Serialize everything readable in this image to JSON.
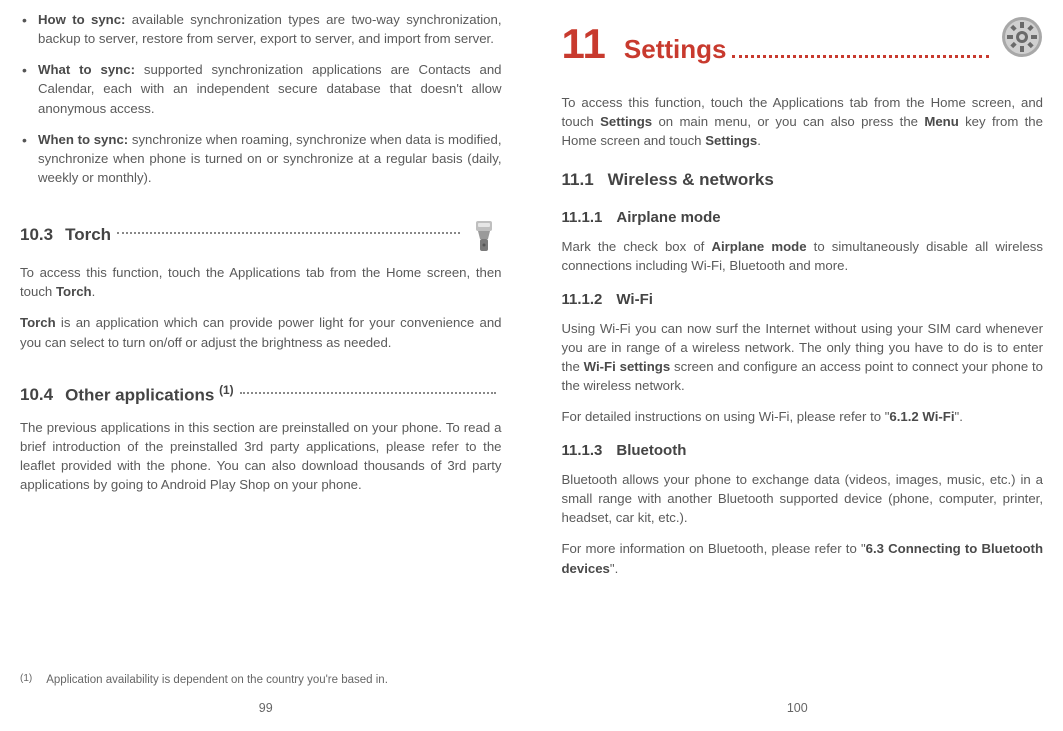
{
  "left": {
    "bullets": [
      {
        "title": "How to sync:",
        "text": " available synchronization types are two-way synchronization, backup to server, restore from server, export to server, and import from server."
      },
      {
        "title": "What to sync:",
        "text": " supported synchronization applications are Contacts and Calendar, each with an independent secure database that doesn't allow anonymous access."
      },
      {
        "title": "When to sync:",
        "text": " synchronize when roaming, synchronize when data is modified, synchronize when phone is turned on or synchronize at a regular basis (daily, weekly or monthly)."
      }
    ],
    "section_10_3": {
      "num": "10.3",
      "title": "Torch"
    },
    "torch_p1_a": "To access this function, touch the Applications tab from the Home screen, then touch ",
    "torch_p1_b": "Torch",
    "torch_p1_c": ".",
    "torch_p2_a": "Torch",
    "torch_p2_b": " is an application which can provide power light for your convenience and you can select to turn on/off or adjust the brightness as needed.",
    "section_10_4": {
      "num": "10.4",
      "title_a": "Other applications ",
      "title_sup": "(1)"
    },
    "other_apps_p": "The previous applications in this section are preinstalled on your phone. To read a brief introduction of the preinstalled 3rd party applications, please refer to the leaflet provided with the phone. You can also download thousands of 3rd party applications by going to Android Play Shop on your phone.",
    "footnote": {
      "mark": "(1)",
      "text": "Application availability is dependent on the country you're based in."
    },
    "page_number": "99"
  },
  "right": {
    "chapter": {
      "num": "11",
      "title": "Settings"
    },
    "intro_a": "To access this function, touch the Applications tab from the Home screen, and touch ",
    "intro_b": "Settings",
    "intro_c": " on main menu, or you can also press the ",
    "intro_d": "Menu",
    "intro_e": " key from the Home screen and touch ",
    "intro_f": "Settings",
    "intro_g": ".",
    "sec_11_1": {
      "num": "11.1",
      "title": "Wireless & networks"
    },
    "sec_11_1_1": {
      "num": "11.1.1",
      "title": "Airplane mode"
    },
    "airplane_a": "Mark the check box of ",
    "airplane_b": "Airplane mode",
    "airplane_c": " to simultaneously disable all wireless connections including Wi-Fi, Bluetooth and more.",
    "sec_11_1_2": {
      "num": "11.1.2",
      "title": "Wi-Fi"
    },
    "wifi_p1_a": "Using Wi-Fi you can now surf the Internet without using your SIM card whenever you are in range of a wireless network. The only thing you have to do is to enter the ",
    "wifi_p1_b": "Wi-Fi settings",
    "wifi_p1_c": " screen and configure an access point to connect your phone to the wireless network.",
    "wifi_p2_a": "For detailed instructions on using Wi-Fi, please refer to \"",
    "wifi_p2_b": "6.1.2 Wi-Fi",
    "wifi_p2_c": "\".",
    "sec_11_1_3": {
      "num": "11.1.3",
      "title": "Bluetooth"
    },
    "bt_p1": "Bluetooth allows your phone to exchange data (videos, images, music, etc.) in a small range with another Bluetooth supported device (phone, computer, printer, headset, car kit, etc.).",
    "bt_p2_a": "For more information on Bluetooth, please refer to \"",
    "bt_p2_b": "6.3 Connecting to Bluetooth devices",
    "bt_p2_c": "\".",
    "page_number": "100"
  }
}
